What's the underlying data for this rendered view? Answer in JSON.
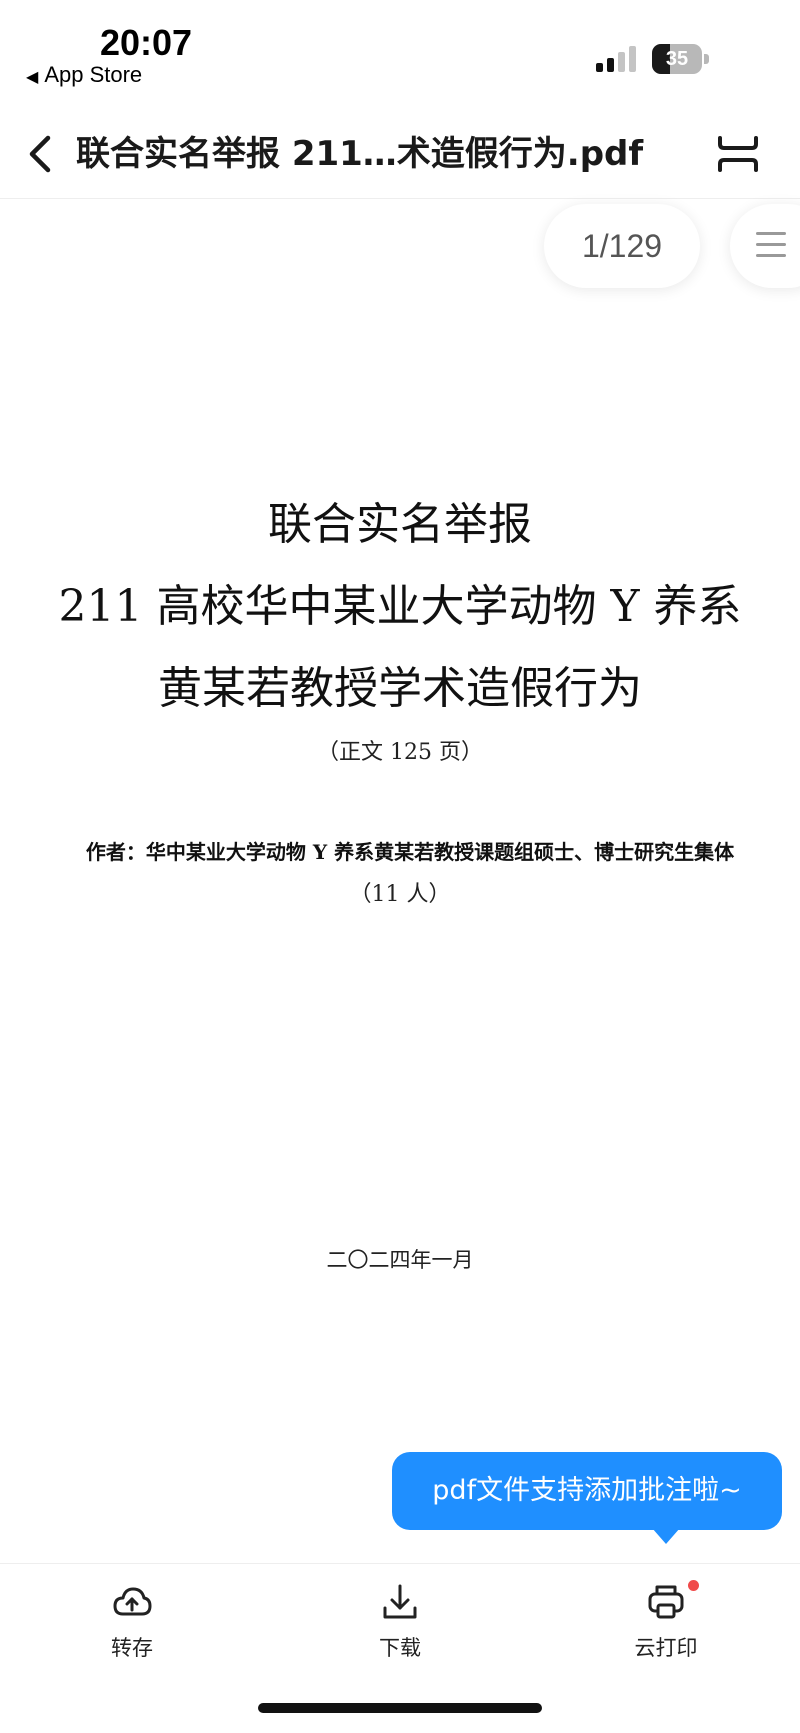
{
  "status_bar": {
    "time": "20:07",
    "back_app": "App Store",
    "battery_level": "35",
    "battery_fraction": 0.35
  },
  "header": {
    "title": "联合实名举报 211…术造假行为.pdf",
    "back_icon": "chevron-left-icon",
    "more_icon": "expand-icon"
  },
  "viewer": {
    "page_indicator": "1/129",
    "toc_icon": "list-icon"
  },
  "document": {
    "line1": "联合实名举报",
    "line2": "211 高校华中某业大学动物 Y 养系",
    "line3": "黄某若教授学术造假行为",
    "page_count_note": "（正文 125 页）",
    "author": "作者：华中某业大学动物 Y 养系黄某若教授课题组硕士、博士研究生集体",
    "author_count": "（11 人）",
    "date": "二〇二四年一月"
  },
  "toast": {
    "text": "pdf文件支持添加批注啦~",
    "color": "#1f8fff"
  },
  "toolbar": {
    "save": {
      "label": "转存",
      "icon": "cloud-upload-icon"
    },
    "download": {
      "label": "下载",
      "icon": "download-icon"
    },
    "print": {
      "label": "云打印",
      "icon": "printer-icon",
      "badge_color": "#f04a4a"
    }
  }
}
